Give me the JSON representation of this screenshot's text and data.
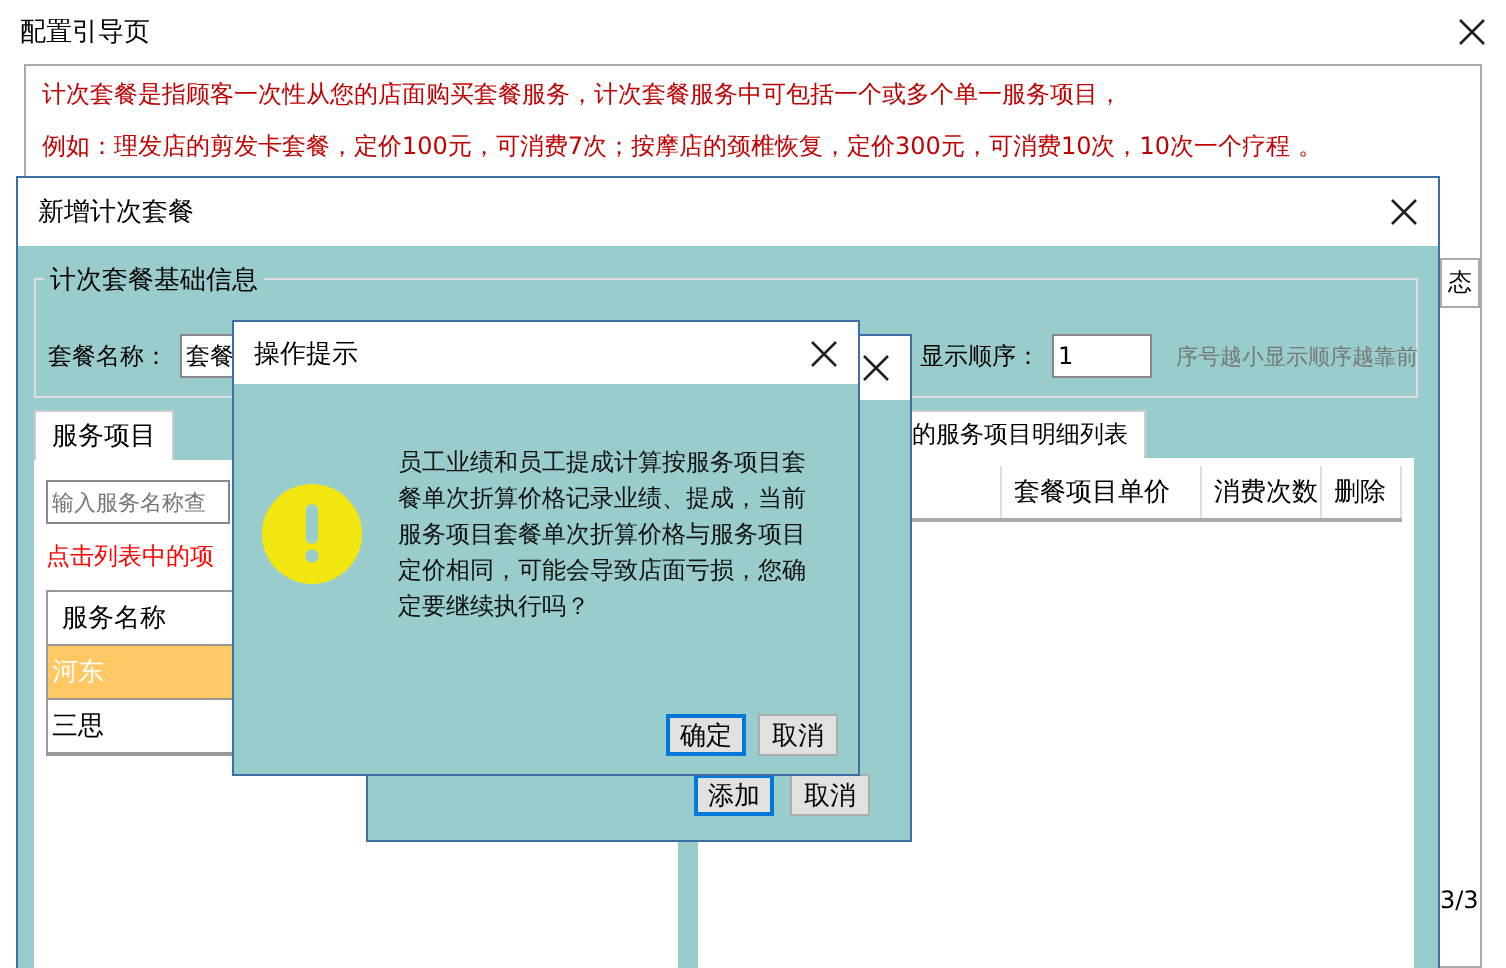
{
  "main_window": {
    "title": "配置引导页",
    "hint_lines": [
      "计次套餐是指顾客一次性从您的店面购买套餐服务，计次套餐服务中可包括一个或多个单一服务项目，",
      "例如：理发店的剪发卡套餐，定价100元，可消费7次；按摩店的颈椎恢复，定价300元，可消费10次，10次一个疗程 。"
    ],
    "side_button": "态",
    "page_indicator": "3/3"
  },
  "package_dialog": {
    "title": "新增计次套餐",
    "section_title": "计次套餐基础信息",
    "name_label": "套餐名称：",
    "name_value": "套餐",
    "order_label": "显示顺序：",
    "order_value": "1",
    "order_hint": "序号越小显示顺序越靠前",
    "left_tab": {
      "label": "服务项目",
      "selected": true
    },
    "search": {
      "placeholder": "输入服务名称查"
    },
    "list_hint": "点击列表中的项",
    "list_header": "服务名称",
    "services": [
      {
        "name": "河东",
        "selected": true
      },
      {
        "name": "三思",
        "selected": false
      }
    ],
    "right_tab": {
      "label": "的服务项目明细列表",
      "selected": true
    },
    "detail_columns": [
      "套餐项目单价",
      "消费次数",
      "删除"
    ]
  },
  "item_dialog": {
    "buttons": [
      {
        "label": "添加",
        "focused": true
      },
      {
        "label": "取消",
        "focused": false
      }
    ]
  },
  "alert": {
    "title": "操作提示",
    "message": "员工业绩和员工提成计算按服务项目套餐单次折算价格记录业绩、提成，当前服务项目套餐单次折算价格与服务项目定价相同，可能会导致店面亏损，您确定要继续执行吗？",
    "buttons": [
      {
        "label": "确定",
        "focused": true
      },
      {
        "label": "取消",
        "focused": false
      }
    ]
  }
}
